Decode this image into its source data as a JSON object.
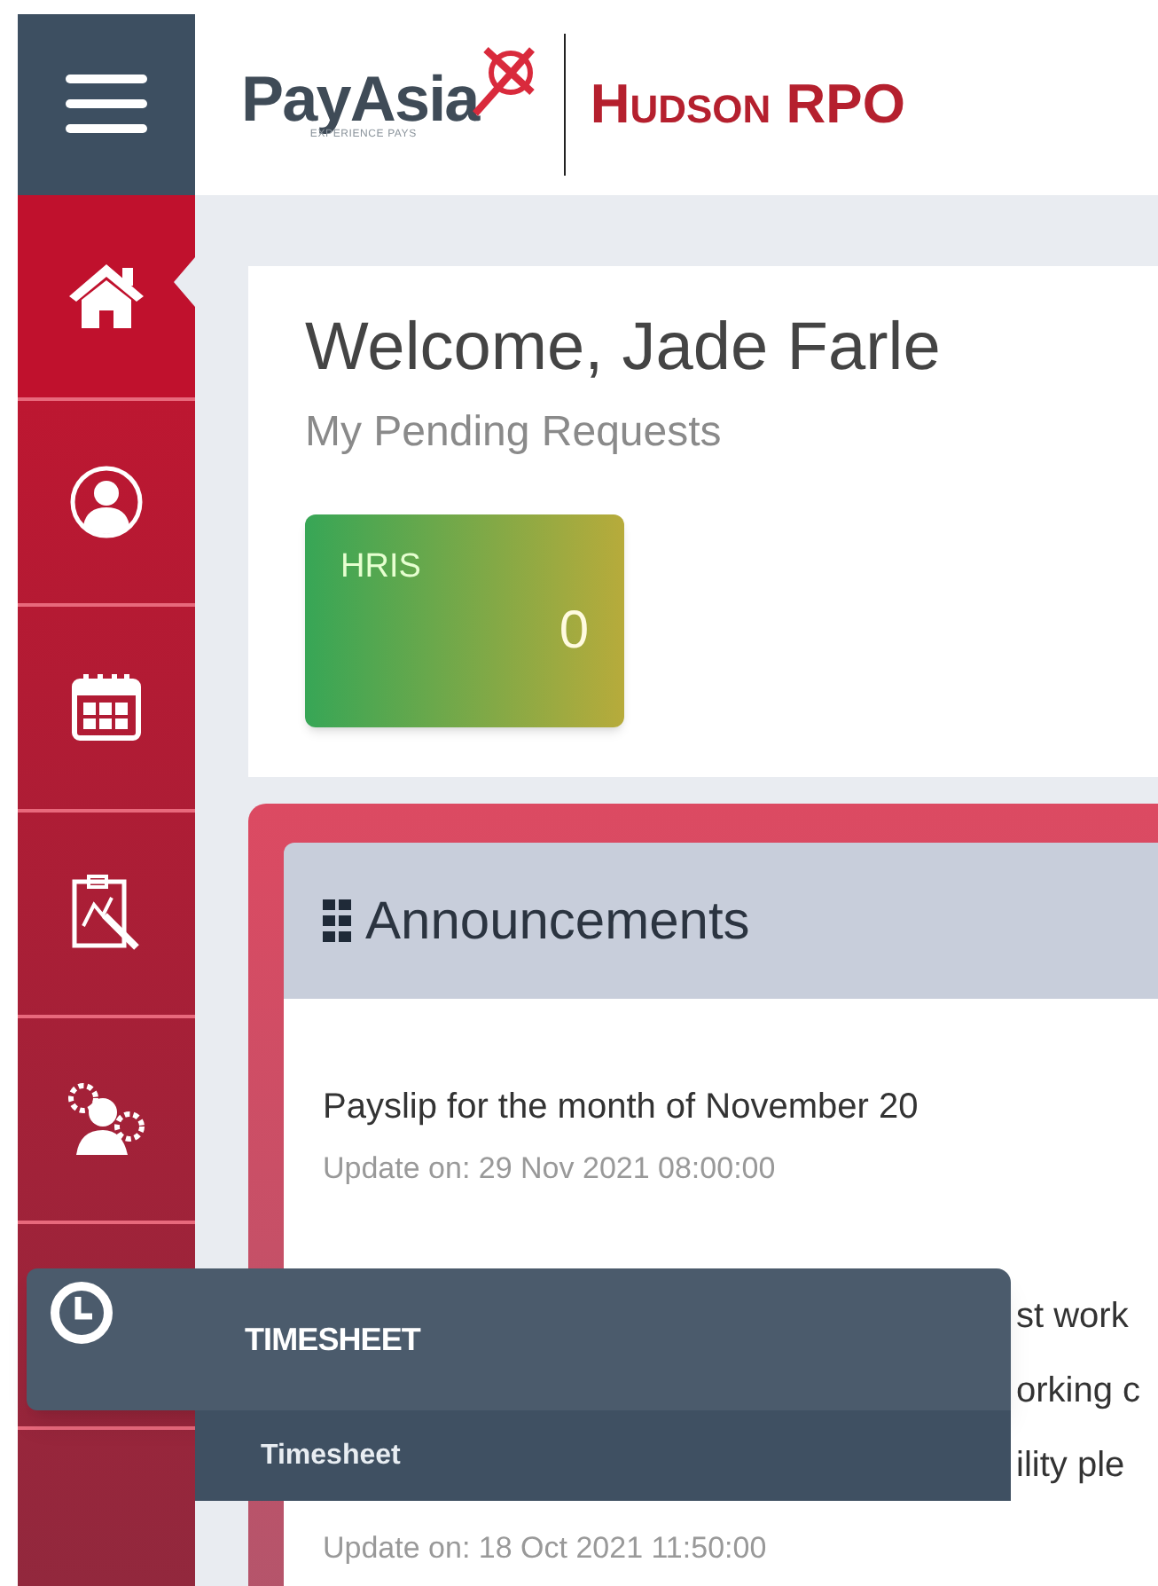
{
  "brand": {
    "name": "PayAsia",
    "tagline": "EXPERIENCE PAYS",
    "client": "Hudson RPO"
  },
  "sidebar": {
    "items": [
      {
        "kind": "home",
        "selected": true
      },
      {
        "kind": "profile",
        "selected": false
      },
      {
        "kind": "calendar",
        "selected": false
      },
      {
        "kind": "report",
        "selected": false
      },
      {
        "kind": "team",
        "selected": false
      }
    ]
  },
  "welcome": {
    "title": "Welcome, Jade Farle",
    "subtitle": "My Pending Requests",
    "tiles": [
      {
        "label": "HRIS",
        "count": "0"
      }
    ]
  },
  "announcements": {
    "title": "Announcements",
    "items": [
      {
        "lines": [
          "Payslip for the month of November 20"
        ],
        "updated": "Update on: 29 Nov 2021 08:00:00"
      },
      {
        "lines": [
          "st work",
          "orking c",
          "ility ple"
        ],
        "updated": "Update on: 18 Oct 2021 11:50:00"
      }
    ]
  },
  "flyout": {
    "title": "TIMESHEET",
    "items": [
      "Timesheet"
    ]
  }
}
